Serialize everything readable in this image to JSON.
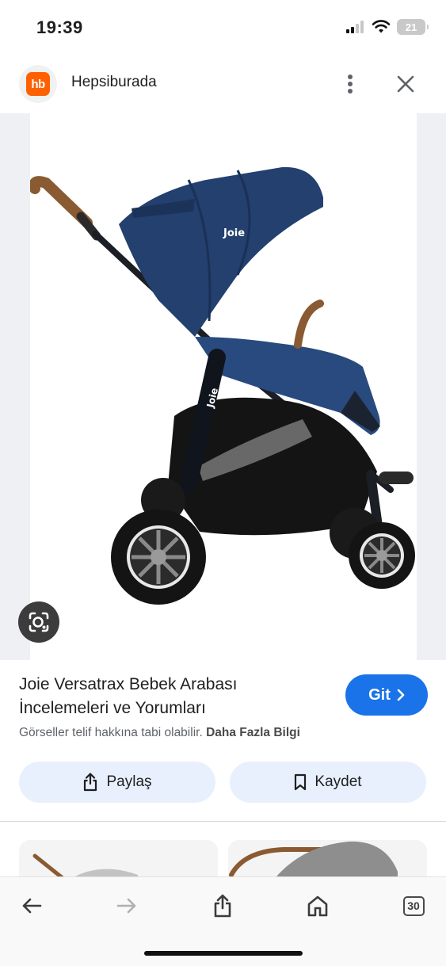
{
  "status_bar": {
    "time": "19:39",
    "battery_level": "21"
  },
  "header": {
    "logo_text": "hb",
    "site_name": "Hepsiburada",
    "logo_color": "#ff6000",
    "menu_icon": "more-vert-icon",
    "close_icon": "close-icon"
  },
  "image": {
    "brand_mark": "Joie",
    "lens_icon": "google-lens-icon"
  },
  "result": {
    "title": "Joie Versatrax Bebek Arabası İncelemeleri ve Yorumları",
    "visit_label": "Git",
    "copyright_text": "Görseller telif hakkına tabi olabilir.",
    "learn_more_label": "Daha Fazla Bilgi"
  },
  "actions": {
    "share_label": "Paylaş",
    "save_label": "Kaydet"
  },
  "bottom_nav": {
    "tab_count": "30"
  },
  "colors": {
    "accent": "#1a73e8",
    "chip_bg": "#e8f0fe"
  }
}
